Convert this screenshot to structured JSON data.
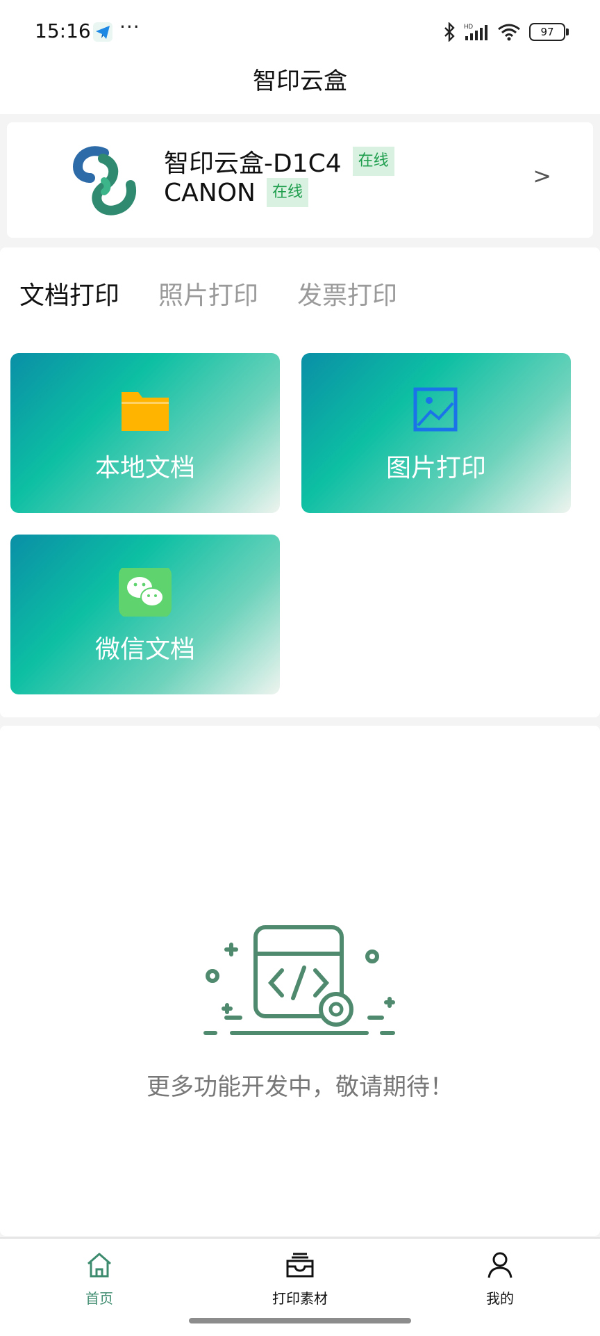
{
  "status_bar": {
    "time": "15:16",
    "more": "···",
    "battery": "97",
    "icons": [
      "telegram-icon",
      "bluetooth-icon",
      "cellular-signal-icon",
      "wifi-icon",
      "battery-icon"
    ]
  },
  "header": {
    "title": "智印云盒"
  },
  "device": {
    "box_name": "智印云盒-D1C4",
    "box_status": "在线",
    "printer_name": "CANON",
    "printer_status": "在线",
    "chevron": ">",
    "status_color": "#1e9e4d"
  },
  "print_tabs": [
    {
      "label": "文档打印",
      "active": true
    },
    {
      "label": "照片打印",
      "active": false
    },
    {
      "label": "发票打印",
      "active": false
    }
  ],
  "tiles": [
    {
      "label": "本地文档",
      "icon": "folder-icon"
    },
    {
      "label": "图片打印",
      "icon": "image-icon"
    },
    {
      "label": "微信文档",
      "icon": "wechat-icon"
    }
  ],
  "empty_state": {
    "text": "更多功能开发中，敬请期待！"
  },
  "bottom_nav": [
    {
      "label": "首页",
      "icon": "home-icon",
      "active": true
    },
    {
      "label": "打印素材",
      "icon": "inbox-tray-icon",
      "active": false
    },
    {
      "label": "我的",
      "icon": "user-icon",
      "active": false
    }
  ],
  "colors": {
    "accent": "#3d8b6e",
    "tile_gradient_start": "#0a8fa6",
    "tile_gradient_end": "#eef4ef",
    "folder": "#ffb400",
    "image_icon": "#1a73e8",
    "wechat": "#5fd36e"
  }
}
